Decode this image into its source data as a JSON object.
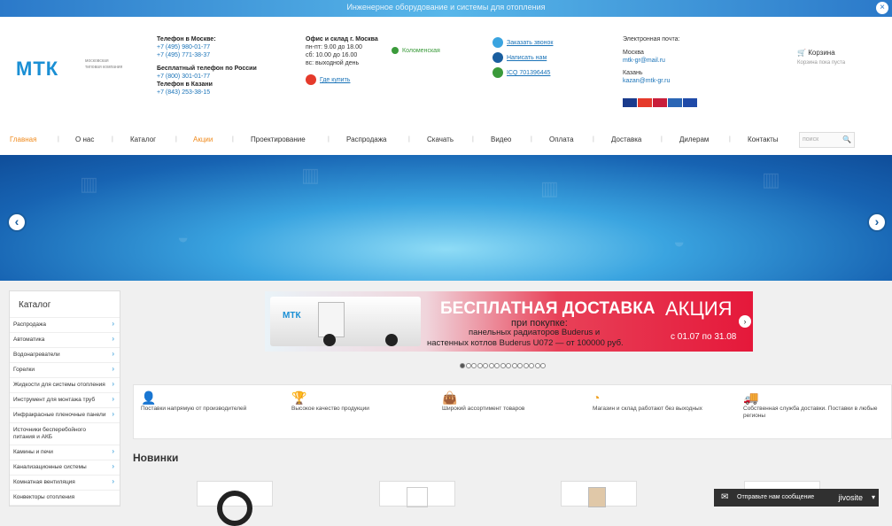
{
  "topbar": {
    "text": "Инженерное оборудование и системы для отопления",
    "close": "×"
  },
  "logo": {
    "name": "МТК",
    "sub": "московская типовая компания"
  },
  "phones": {
    "moscow_label": "Телефон в Москве:",
    "moscow_1": "+7 (495) 980-01-77",
    "moscow_2": "+7 (495) 771-38-37",
    "free_label": "Бесплатный телефон по России",
    "free_1": "+7 (800) 301-01-77",
    "kazan_label": "Телефон в Казани",
    "kazan_1": "+7 (843) 253-38-15"
  },
  "office": {
    "label": "Офис и склад г. Москва",
    "hours_1": "пн-пт: 9.00 до 18.00",
    "hours_2": "сб: 10.00 до 16.00",
    "hours_3": "вс: выходной день",
    "metro": "Коломенская",
    "where_buy": "Где купить"
  },
  "contacts": {
    "callback": "Заказать звонок",
    "write": "Написать нам",
    "icq": "ICQ 701396445"
  },
  "email": {
    "label": "Электронная почта:",
    "moscow_label": "Москва",
    "moscow_email": "mtk-gr@mail.ru",
    "kazan_label": "Казань",
    "kazan_email": "kazan@mtk-gr.ru"
  },
  "payment_colors": [
    "#1a3b8c",
    "#e53a2b",
    "#c91e3a",
    "#2b66b5",
    "#1f4aa8"
  ],
  "cart": {
    "title": "Корзина",
    "sub": "Корзина пока пуста"
  },
  "nav": [
    {
      "label": "Главная"
    },
    {
      "label": "О нас"
    },
    {
      "label": "Каталог"
    },
    {
      "label": "Акции"
    },
    {
      "label": "Проектирование"
    },
    {
      "label": "Распродажа"
    },
    {
      "label": "Скачать"
    },
    {
      "label": "Видео"
    },
    {
      "label": "Оплата"
    },
    {
      "label": "Доставка"
    },
    {
      "label": "Дилерам"
    },
    {
      "label": "Контакты"
    }
  ],
  "search": {
    "placeholder": "поиск"
  },
  "slider": {
    "prev": "‹",
    "next": "›"
  },
  "sidebar": {
    "title": "Каталог",
    "items": [
      {
        "label": "Распродажа"
      },
      {
        "label": "Автоматика"
      },
      {
        "label": "Водонагреватели"
      },
      {
        "label": "Горелки"
      },
      {
        "label": "Жидкости для системы отопления"
      },
      {
        "label": "Инструмент для монтажа труб"
      },
      {
        "label": "Инфракрасные пленочные панели"
      },
      {
        "label": "Источники бесперебойного питания и АКБ"
      },
      {
        "label": "Камины и печи"
      },
      {
        "label": "Канализационные системы"
      },
      {
        "label": "Комнатная вентиляция"
      },
      {
        "label": "Конвекторы отопления"
      }
    ]
  },
  "banner": {
    "headline": "БЕСПЛАТНАЯ ДОСТАВКА",
    "line1": "при покупке:",
    "line2": "панельных радиаторов Buderus и",
    "line3": "настенных котлов Buderus U072 — от 100000 руб.",
    "promo": "АКЦИЯ",
    "dates": "с 01.07 по 31.08",
    "truck_logo": "МТК",
    "arrow": "›"
  },
  "features": [
    {
      "text": "Поставки напрямую от производителей"
    },
    {
      "text": "Высокое качество продукции"
    },
    {
      "text": "Широкий ассортимент товаров"
    },
    {
      "text": "Магазин и склад работают без выходных"
    },
    {
      "text": "Собственная служба доставки. Поставки в любые регионы"
    }
  ],
  "new_title": "Новинки",
  "jivo": {
    "text": "Отправьте нам сообщение",
    "brand": "jivosite",
    "icon": "envelope-icon"
  }
}
